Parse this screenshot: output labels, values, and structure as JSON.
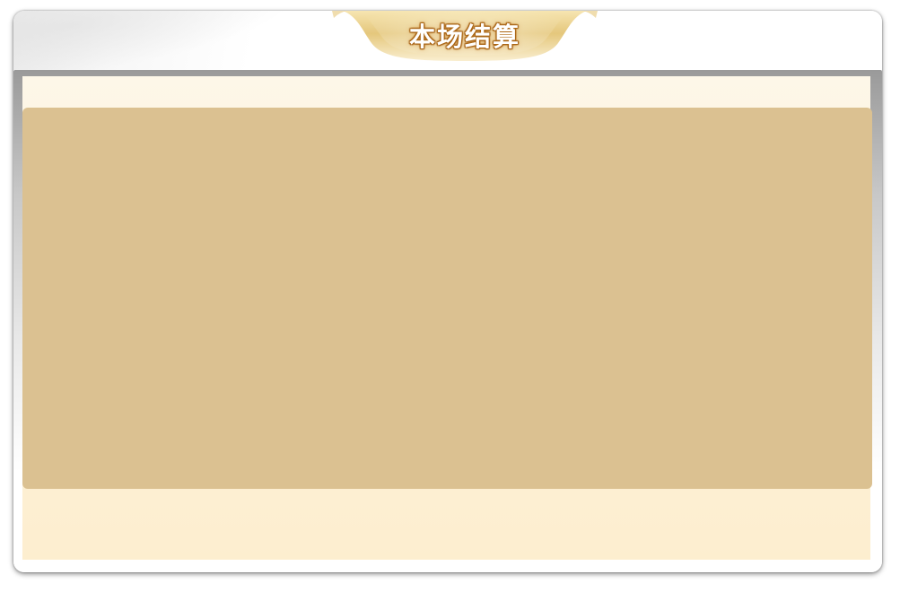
{
  "dialog": {
    "title": "本场结算",
    "colors": {
      "title_plate_gold": "#e8c977",
      "title_text_stroke": "#b06a16",
      "panel_background": "#dbc191",
      "body_background": "#fdf1d8",
      "frame_border": "#9a9a9a"
    }
  },
  "results_panel": {
    "entries": []
  }
}
